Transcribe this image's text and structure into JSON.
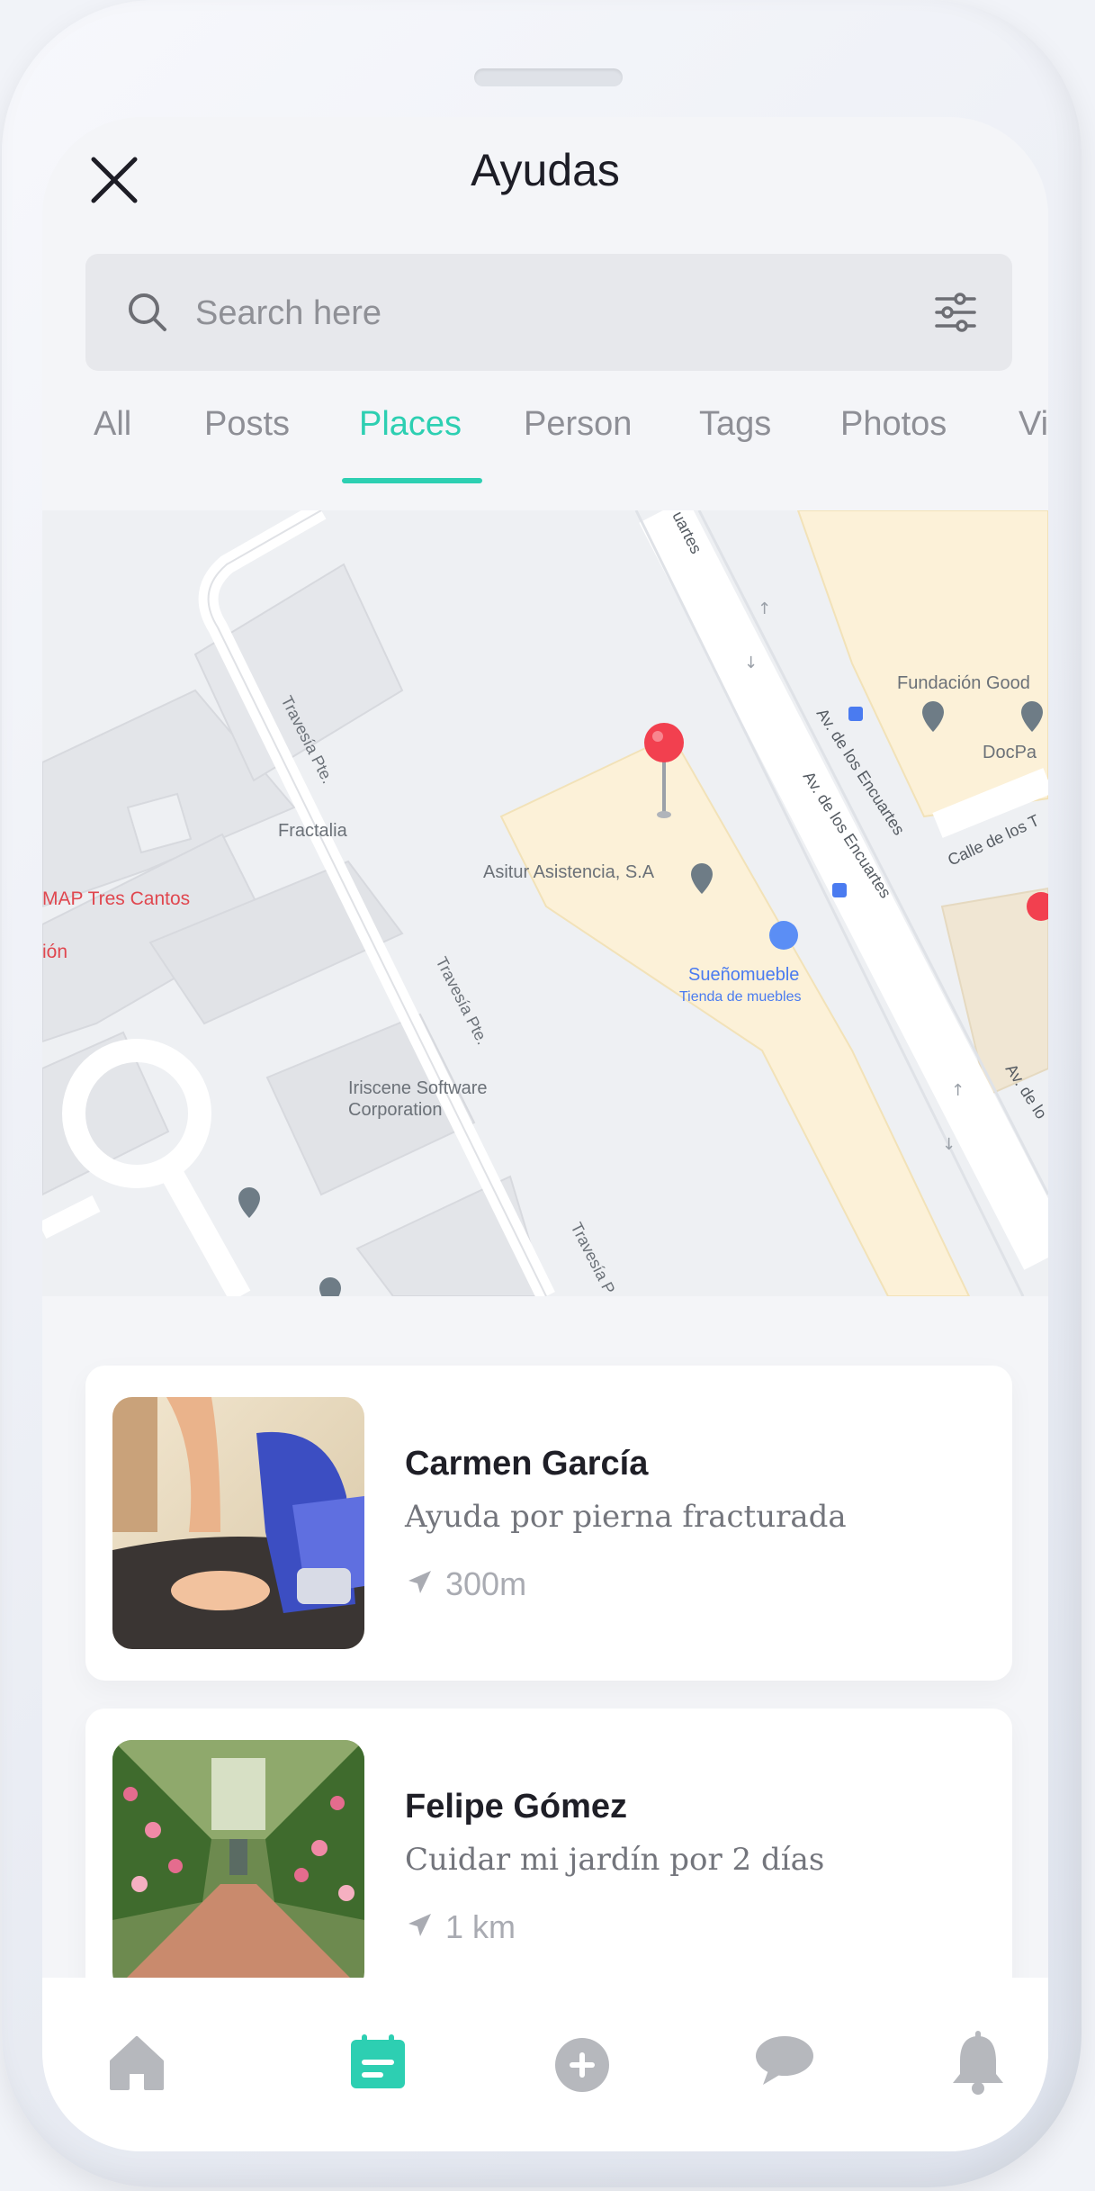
{
  "header": {
    "title": "Ayudas"
  },
  "search": {
    "placeholder": "Search here"
  },
  "tabs": [
    {
      "label": "All"
    },
    {
      "label": "Posts"
    },
    {
      "label": "Places",
      "active": true
    },
    {
      "label": "Person"
    },
    {
      "label": "Tags"
    },
    {
      "label": "Photos"
    },
    {
      "label": "Vi"
    }
  ],
  "map": {
    "labels": {
      "map_tres_cantos": "MAP Tres Cantos",
      "ion": "ión",
      "travesia_1": "Travesía Pte.",
      "travesia_2": "Travesía Pte.",
      "travesia_3": "Travesía P",
      "fractalia": "Fractalia",
      "iriscene_1": "Iriscene Software",
      "iriscene_2": "Corporation",
      "asitur": "Asitur Asistencia, S.A",
      "suenomueble": "Sueñomueble",
      "tienda": "Tienda de muebles",
      "fundacion": "Fundación Good",
      "docpa": "DocPa",
      "av1": "Av. de los Encuartes",
      "av2": "Av. de los Encuartes",
      "av3": "Av. de lo",
      "calle": "Calle de los T",
      "uartes": "uartes"
    },
    "accent_pin": "#f2404f",
    "fab_color": "#f5515f"
  },
  "cards": [
    {
      "name": "Carmen García",
      "description": "Ayuda por pierna fracturada",
      "distance": "300m"
    },
    {
      "name": "Felipe Gómez",
      "description": "Cuidar mi jardín por 2 días",
      "distance": "1 km"
    }
  ],
  "bottom_nav": [
    {
      "icon": "home-icon"
    },
    {
      "icon": "list-icon",
      "active": true
    },
    {
      "icon": "add-icon"
    },
    {
      "icon": "chat-icon"
    },
    {
      "icon": "bell-icon"
    }
  ],
  "colors": {
    "accent": "#2dcfb2",
    "fab": "#f5515f"
  }
}
